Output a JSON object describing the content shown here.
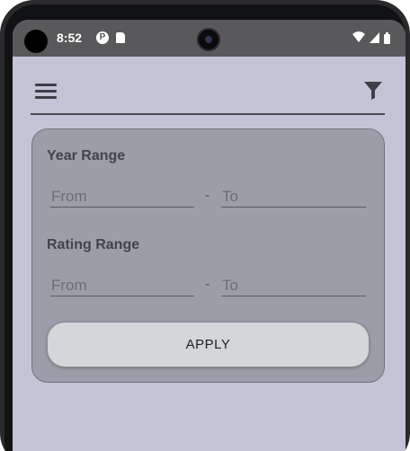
{
  "status_bar": {
    "time": "8:52",
    "left_icons": [
      "app-notification-icon",
      "sd-card-icon"
    ],
    "right_icons": [
      "wifi-icon",
      "cellular-signal-icon",
      "battery-icon"
    ]
  },
  "app_bar": {
    "menu_icon": "hamburger-menu-icon",
    "filter_icon": "filter-funnel-icon"
  },
  "filter": {
    "year_range": {
      "label": "Year Range",
      "from_placeholder": "From",
      "separator": "-",
      "to_placeholder": "To",
      "from_value": "",
      "to_value": ""
    },
    "rating_range": {
      "label": "Rating Range",
      "from_placeholder": "From",
      "separator": "-",
      "to_placeholder": "To",
      "from_value": "",
      "to_value": ""
    },
    "apply_label": "APPLY"
  },
  "colors": {
    "screen_background": "#c3c5d6",
    "card_background": "#9b9ea8",
    "status_bar": "#59595b",
    "button_background": "#d4d6da"
  }
}
